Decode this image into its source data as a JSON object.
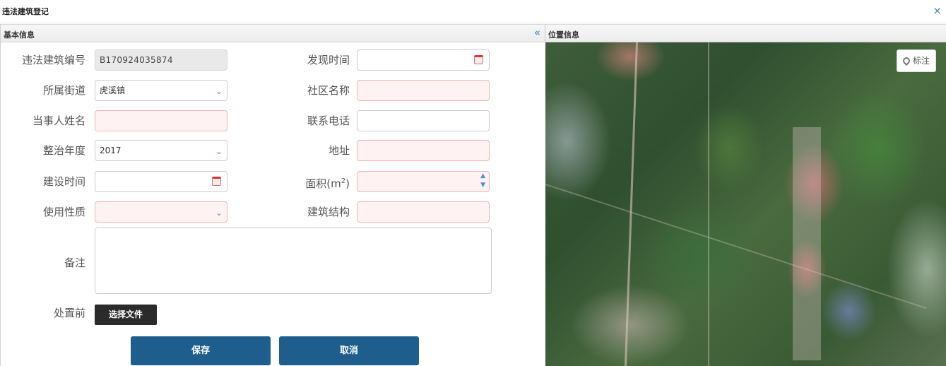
{
  "window": {
    "title": "违法建筑登记",
    "close_glyph": "×"
  },
  "left_panel": {
    "title": "基本信息",
    "collapse_glyph": "«"
  },
  "right_panel": {
    "title": "位置信息",
    "mark_label": "标注"
  },
  "form": {
    "building_no": {
      "label": "违法建筑编号",
      "value": "B170924035874"
    },
    "discover_time": {
      "label": "发现时间",
      "value": ""
    },
    "street": {
      "label": "所属街道",
      "value": "虎溪镇"
    },
    "community": {
      "label": "社区名称",
      "value": ""
    },
    "party_name": {
      "label": "当事人姓名",
      "value": ""
    },
    "phone": {
      "label": "联系电话",
      "value": ""
    },
    "year": {
      "label": "整治年度",
      "value": "2017"
    },
    "address": {
      "label": "地址",
      "value": ""
    },
    "build_time": {
      "label": "建设时间",
      "value": ""
    },
    "area": {
      "label": "面积(m",
      "sup": "2",
      "close": ")",
      "value": ""
    },
    "usage": {
      "label": "使用性质",
      "value": ""
    },
    "structure": {
      "label": "建筑结构",
      "value": ""
    },
    "remark": {
      "label": "备注",
      "value": ""
    },
    "before": {
      "label": "处置前",
      "button": "选择文件"
    }
  },
  "actions": {
    "save": "保存",
    "cancel": "取消"
  },
  "colors": {
    "primary": "#1f5d8c",
    "accent": "#3a7fc6",
    "required_bg": "#fff2f2"
  }
}
